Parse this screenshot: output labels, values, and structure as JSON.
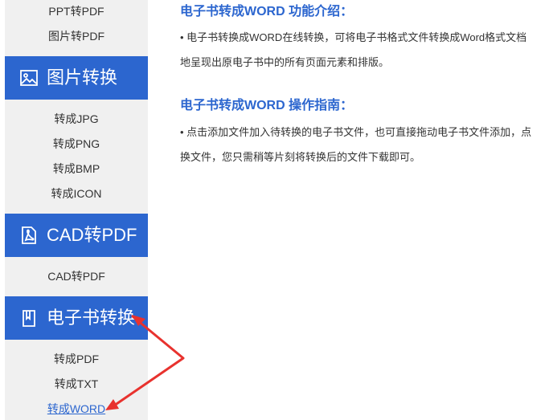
{
  "sidebar": {
    "ppt_group": {
      "links": [
        "PPT转PDF",
        "图片转PDF"
      ]
    },
    "image_convert": {
      "title": "图片转换",
      "icon": "image-icon",
      "links": [
        "转成JPG",
        "转成PNG",
        "转成BMP",
        "转成ICON"
      ]
    },
    "cad_pdf": {
      "title": "CAD转PDF",
      "icon": "pdf-icon",
      "links": [
        "CAD转PDF"
      ]
    },
    "ebook_convert": {
      "title": "电子书转换",
      "icon": "book-icon",
      "links": [
        "转成PDF",
        "转成TXT",
        "转成WORD"
      ],
      "active_link": "转成WORD"
    }
  },
  "content": {
    "intro": {
      "heading": "电子书转成WORD 功能介绍：",
      "lines": [
        "• 电子书转换成WORD在线转换，可将电子书格式文件转换成Word格式文档",
        "地呈现出原电子书中的所有页面元素和排版。"
      ]
    },
    "guide": {
      "heading": "电子书转成WORD 操作指南：",
      "lines": [
        "• 点击添加文件加入待转换的电子书文件，也可直接拖动电子书文件添加，点",
        "换文件，您只需稍等片刻将转换后的文件下载即可。"
      ]
    }
  },
  "colors": {
    "accent": "#2c66cf",
    "sidebar_bg": "#f0f0f0",
    "annotation": "#e8322e"
  }
}
